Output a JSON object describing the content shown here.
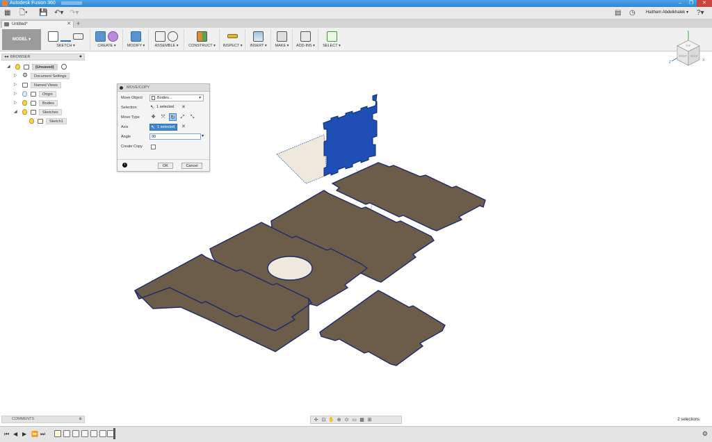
{
  "app": {
    "title": "Autodesk Fusion 360",
    "user": "Haithem Abdelkhalek",
    "doc_tab": "Untitled*"
  },
  "toolbar": {
    "workspace": "MODEL",
    "groups": [
      {
        "label": "SKETCH"
      },
      {
        "label": "CREATE"
      },
      {
        "label": "MODIFY"
      },
      {
        "label": "ASSEMBLE"
      },
      {
        "label": "CONSTRUCT"
      },
      {
        "label": "INSPECT"
      },
      {
        "label": "INSERT"
      },
      {
        "label": "MAKE"
      },
      {
        "label": "ADD-INS"
      },
      {
        "label": "SELECT"
      }
    ]
  },
  "browser": {
    "title": "BROWSER",
    "root": "(Unsaved)",
    "items": [
      {
        "label": "Document Settings"
      },
      {
        "label": "Named Views"
      },
      {
        "label": "Origin"
      },
      {
        "label": "Bodies"
      },
      {
        "label": "Sketches"
      },
      {
        "label": "Sketch1"
      }
    ]
  },
  "dialog": {
    "title": "MOVE/COPY",
    "move_object_label": "Move Object",
    "move_object_value": "Bodies...",
    "selection_label": "Selection",
    "selection_value": "1 selected",
    "move_type_label": "Move Type",
    "axis_label": "Axis",
    "axis_value": "1 selected",
    "angle_label": "Angle",
    "angle_value": "90",
    "create_copy_label": "Create Copy",
    "ok": "OK",
    "cancel": "Cancel"
  },
  "viewcube": {
    "top": "TOP",
    "front": "FRONT",
    "right": "RIGHT",
    "axis_x": "X",
    "axis_y": "Y",
    "axis_z": "Z"
  },
  "status": {
    "comments": "COMMENTS",
    "selections": "2 selections"
  },
  "colors": {
    "panel_fill": "#6b5d4a",
    "panel_edge": "#1f2a6b",
    "selected_body": "#1f4fb4",
    "accent": "#3f87c6"
  }
}
